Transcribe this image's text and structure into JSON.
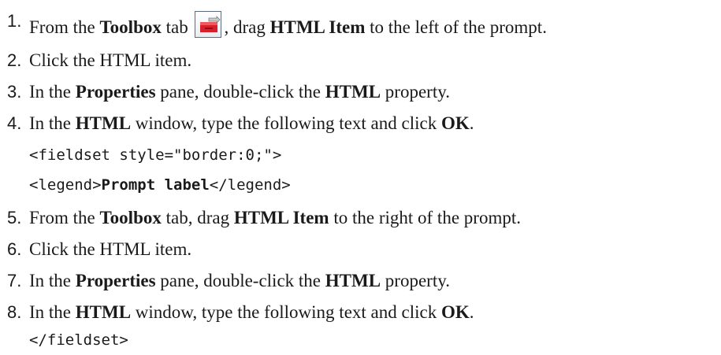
{
  "steps": [
    {
      "num": "1.",
      "parts": [
        {
          "t": "From the ",
          "b": false
        },
        {
          "t": "Toolbox",
          "b": true
        },
        {
          "t": " tab ",
          "b": false
        },
        {
          "icon": "toolbox-icon"
        },
        {
          "t": ", drag ",
          "b": false
        },
        {
          "t": "HTML Item",
          "b": true
        },
        {
          "t": " to the left of the prompt.",
          "b": false
        }
      ]
    },
    {
      "num": "2.",
      "parts": [
        {
          "t": "Click the HTML item.",
          "b": false
        }
      ]
    },
    {
      "num": "3.",
      "parts": [
        {
          "t": "In the ",
          "b": false
        },
        {
          "t": "Properties",
          "b": true
        },
        {
          "t": " pane, double-click the ",
          "b": false
        },
        {
          "t": "HTML",
          "b": true
        },
        {
          "t": " property.",
          "b": false
        }
      ]
    },
    {
      "num": "4.",
      "parts": [
        {
          "t": "In the ",
          "b": false
        },
        {
          "t": "HTML",
          "b": true
        },
        {
          "t": " window, type the following text and click ",
          "b": false
        },
        {
          "t": "OK",
          "b": true
        },
        {
          "t": ".",
          "b": false
        }
      ]
    },
    {
      "code": [
        {
          "t": "<fieldset style=\"border:0;\">",
          "b": false
        }
      ]
    },
    {
      "code": [
        {
          "t": "<legend>",
          "b": false
        },
        {
          "t": "Prompt label",
          "b": true
        },
        {
          "t": "</legend>",
          "b": false
        }
      ]
    },
    {
      "num": "5.",
      "parts": [
        {
          "t": "From the ",
          "b": false
        },
        {
          "t": "Toolbox",
          "b": true
        },
        {
          "t": " tab, drag ",
          "b": false
        },
        {
          "t": "HTML Item",
          "b": true
        },
        {
          "t": " to the right of the prompt.",
          "b": false
        }
      ]
    },
    {
      "num": "6.",
      "parts": [
        {
          "t": "Click the HTML item.",
          "b": false
        }
      ]
    },
    {
      "num": "7.",
      "parts": [
        {
          "t": "In the ",
          "b": false
        },
        {
          "t": "Properties",
          "b": true
        },
        {
          "t": " pane, double-click the ",
          "b": false
        },
        {
          "t": "HTML",
          "b": true
        },
        {
          "t": " property.",
          "b": false
        }
      ]
    },
    {
      "num": "8.",
      "parts": [
        {
          "t": "In the ",
          "b": false
        },
        {
          "t": "HTML",
          "b": true
        },
        {
          "t": " window, type the following text and click ",
          "b": false
        },
        {
          "t": "OK",
          "b": true
        },
        {
          "t": ".",
          "b": false
        }
      ]
    },
    {
      "code": [
        {
          "t": "</fieldset>",
          "b": false
        }
      ]
    }
  ]
}
